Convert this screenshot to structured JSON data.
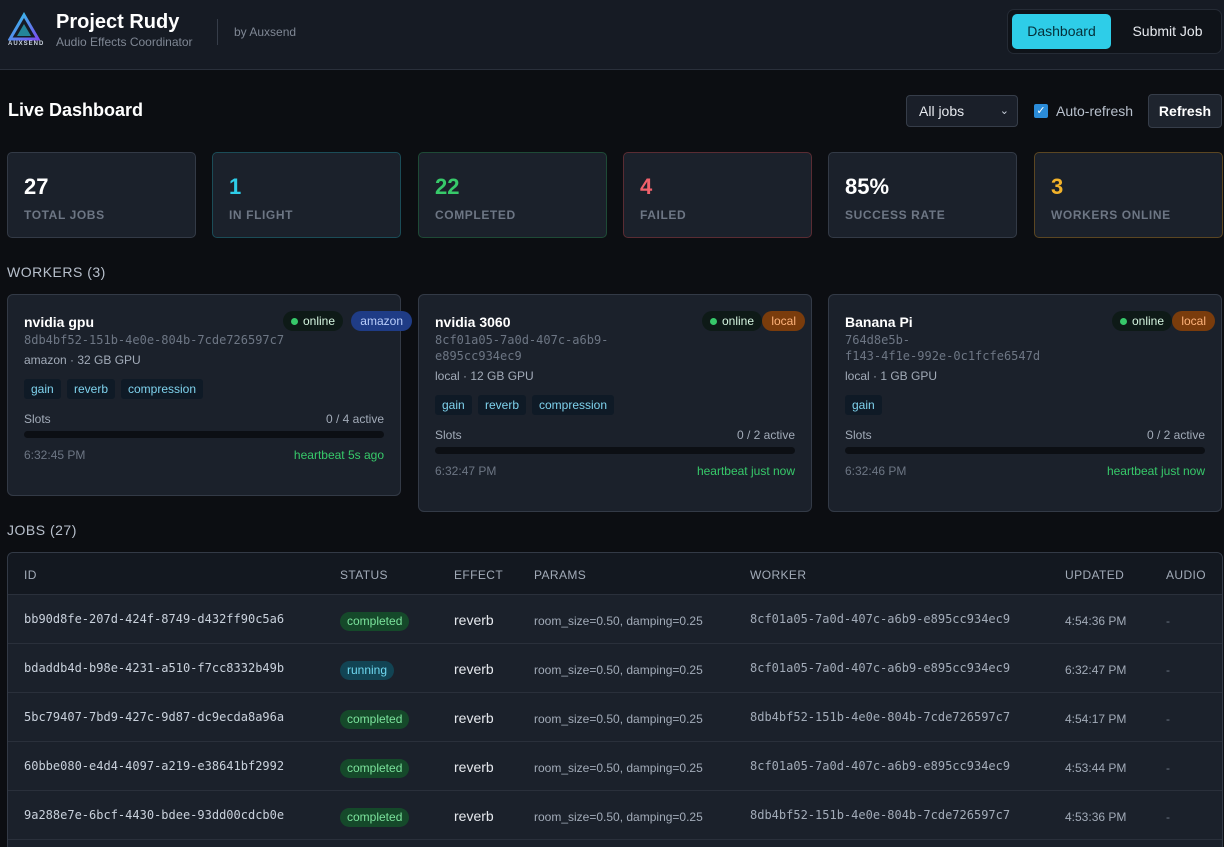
{
  "header": {
    "logo_text": "AUXSEND",
    "title": "Project Rudy",
    "subtitle": "Audio Effects Coordinator",
    "byline": "by Auxsend",
    "nav": [
      {
        "label": "Dashboard",
        "active": true
      },
      {
        "label": "Submit Job",
        "active": false
      }
    ]
  },
  "dashboard": {
    "title": "Live Dashboard",
    "filter": {
      "selected": "All jobs"
    },
    "auto_refresh": {
      "label": "Auto-refresh",
      "checked": true
    },
    "refresh_label": "Refresh"
  },
  "stats": [
    {
      "value": "27",
      "label": "TOTAL JOBS",
      "color": "#ffffff",
      "border": "#333a46"
    },
    {
      "value": "1",
      "label": "IN FLIGHT",
      "color": "#2ecde8",
      "border": "#1b4c57"
    },
    {
      "value": "22",
      "label": "COMPLETED",
      "color": "#37c96a",
      "border": "#1e4a36"
    },
    {
      "value": "4",
      "label": "FAILED",
      "color": "#f0616b",
      "border": "#5a2c33"
    },
    {
      "value": "85%",
      "label": "SUCCESS RATE",
      "color": "#ffffff",
      "border": "#333a46"
    },
    {
      "value": "3",
      "label": "WORKERS ONLINE",
      "color": "#f2b22a",
      "border": "#5b4622"
    }
  ],
  "workers_heading": "WORKERS (3)",
  "workers": [
    {
      "name": "nvidia gpu",
      "id_lines": [
        "8db4bf52-151b-4e0e-804b-7cde726597c7"
      ],
      "status": "online",
      "location": "amazon",
      "meta": "amazon · 32 GB GPU",
      "effects": [
        "gain",
        "reverb",
        "compression"
      ],
      "slots_label": "Slots",
      "slots_text": "0 / 4 active",
      "slots_fraction": 0,
      "time": "6:32:45 PM",
      "heartbeat": "heartbeat 5s ago"
    },
    {
      "name": "nvidia 3060",
      "id_lines": [
        "8cf01a05-7a0d-407c-a6b9-",
        "e895cc934ec9"
      ],
      "status": "online",
      "location": "local",
      "meta": "local · 12 GB GPU",
      "effects": [
        "gain",
        "reverb",
        "compression"
      ],
      "slots_label": "Slots",
      "slots_text": "0 / 2 active",
      "slots_fraction": 0,
      "time": "6:32:47 PM",
      "heartbeat": "heartbeat just now"
    },
    {
      "name": "Banana Pi",
      "id_lines": [
        "764d8e5b-",
        "f143-4f1e-992e-0c1fcfe6547d"
      ],
      "status": "online",
      "location": "local",
      "meta": "local · 1 GB GPU",
      "effects": [
        "gain"
      ],
      "slots_label": "Slots",
      "slots_text": "0 / 2 active",
      "slots_fraction": 0,
      "time": "6:32:46 PM",
      "heartbeat": "heartbeat just now"
    }
  ],
  "jobs_heading": "JOBS (27)",
  "jobs": {
    "columns": [
      "ID",
      "STATUS",
      "EFFECT",
      "PARAMS",
      "WORKER",
      "UPDATED",
      "AUDIO"
    ],
    "rows": [
      {
        "id": "bb90d8fe-207d-424f-8749-d432ff90c5a6",
        "status": "completed",
        "effect": "reverb",
        "params": "room_size=0.50, damping=0.25",
        "worker": "8cf01a05-7a0d-407c-a6b9-e895cc934ec9",
        "updated": "4:54:36 PM",
        "audio": "-"
      },
      {
        "id": "bdaddb4d-b98e-4231-a510-f7cc8332b49b",
        "status": "running",
        "effect": "reverb",
        "params": "room_size=0.50, damping=0.25",
        "worker": "8cf01a05-7a0d-407c-a6b9-e895cc934ec9",
        "updated": "6:32:47 PM",
        "audio": "-"
      },
      {
        "id": "5bc79407-7bd9-427c-9d87-dc9ecda8a96a",
        "status": "completed",
        "effect": "reverb",
        "params": "room_size=0.50, damping=0.25",
        "worker": "8db4bf52-151b-4e0e-804b-7cde726597c7",
        "updated": "4:54:17 PM",
        "audio": "-"
      },
      {
        "id": "60bbe080-e4d4-4097-a219-e38641bf2992",
        "status": "completed",
        "effect": "reverb",
        "params": "room_size=0.50, damping=0.25",
        "worker": "8cf01a05-7a0d-407c-a6b9-e895cc934ec9",
        "updated": "4:53:44 PM",
        "audio": "-"
      },
      {
        "id": "9a288e7e-6bcf-4430-bdee-93dd00cdcb0e",
        "status": "completed",
        "effect": "reverb",
        "params": "room_size=0.50, damping=0.25",
        "worker": "8db4bf52-151b-4e0e-804b-7cde726597c7",
        "updated": "4:53:36 PM",
        "audio": "-"
      }
    ]
  },
  "colors": {
    "accent": "#2ecde8",
    "online": "#37c96a",
    "amazon_badge_bg": "#1f3c86",
    "amazon_badge_fg": "#b9cdfa",
    "local_badge_bg": "#7a3c0c",
    "local_badge_fg": "#ffb37a"
  }
}
